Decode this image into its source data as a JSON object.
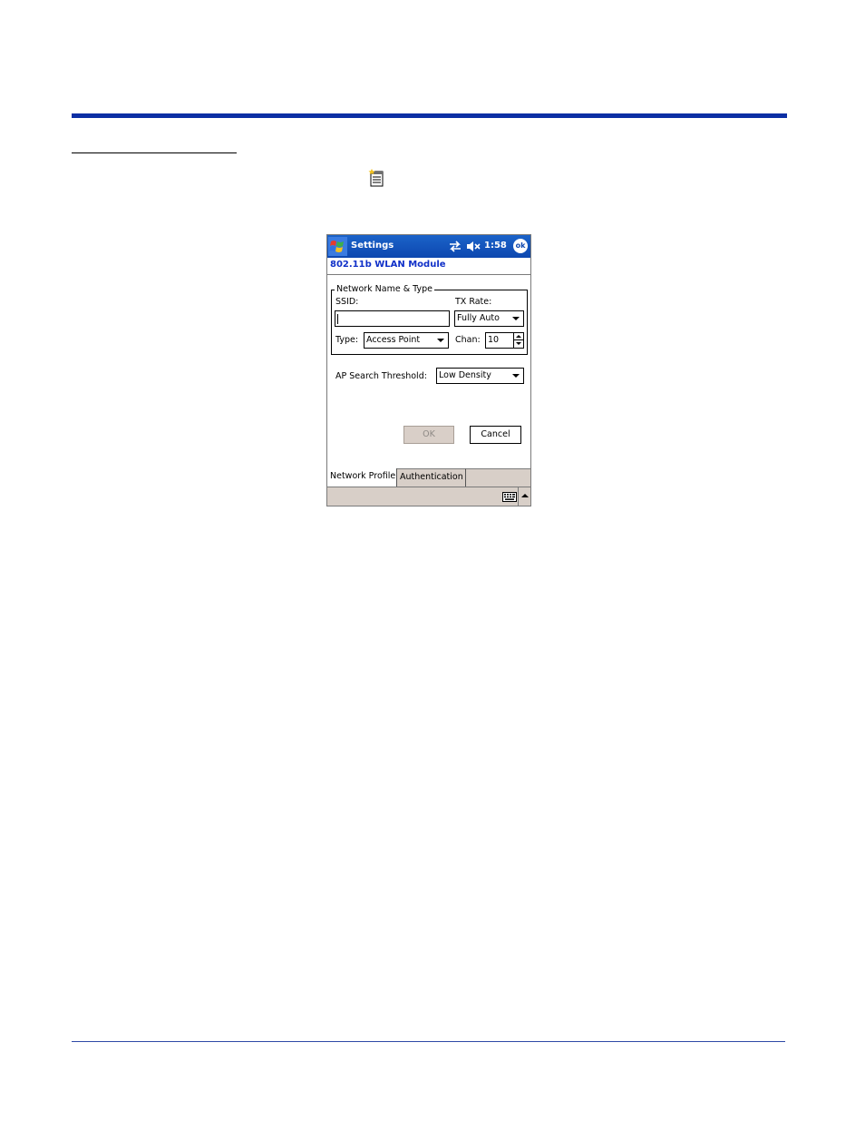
{
  "page": {
    "doc_icon": "notepad-icon"
  },
  "device": {
    "titlebar": {
      "start_icon": "windows-flag-icon",
      "title": "Settings",
      "connectivity_icon": "connection-arrows-icon",
      "volume_icon": "speaker-muted-icon",
      "time": "1:58",
      "ok_label": "ok"
    },
    "header": {
      "title": "802.11b WLAN Module",
      "color": "#1030c8"
    },
    "group": {
      "legend": "Network Name & Type",
      "ssid_label": "SSID:",
      "ssid_value": "",
      "tx_rate_label": "TX Rate:",
      "tx_rate_value": "Fully Auto",
      "type_label": "Type:",
      "type_value": "Access Point",
      "chan_label": "Chan:",
      "chan_value": "10"
    },
    "ap_search": {
      "label": "AP Search Threshold:",
      "value": "Low Density"
    },
    "buttons": {
      "ok": "OK",
      "cancel": "Cancel"
    },
    "tabs": [
      {
        "label": "Network Profile",
        "active": true
      },
      {
        "label": "Authentication",
        "active": false
      }
    ],
    "menubar": {
      "keyboard_icon": "keyboard-icon",
      "sip_icon": "up-arrow-icon"
    },
    "colors": {
      "titlebar": "#0d47b0",
      "chrome": "#d8cfc8",
      "rule": "#0c2fa4"
    }
  }
}
